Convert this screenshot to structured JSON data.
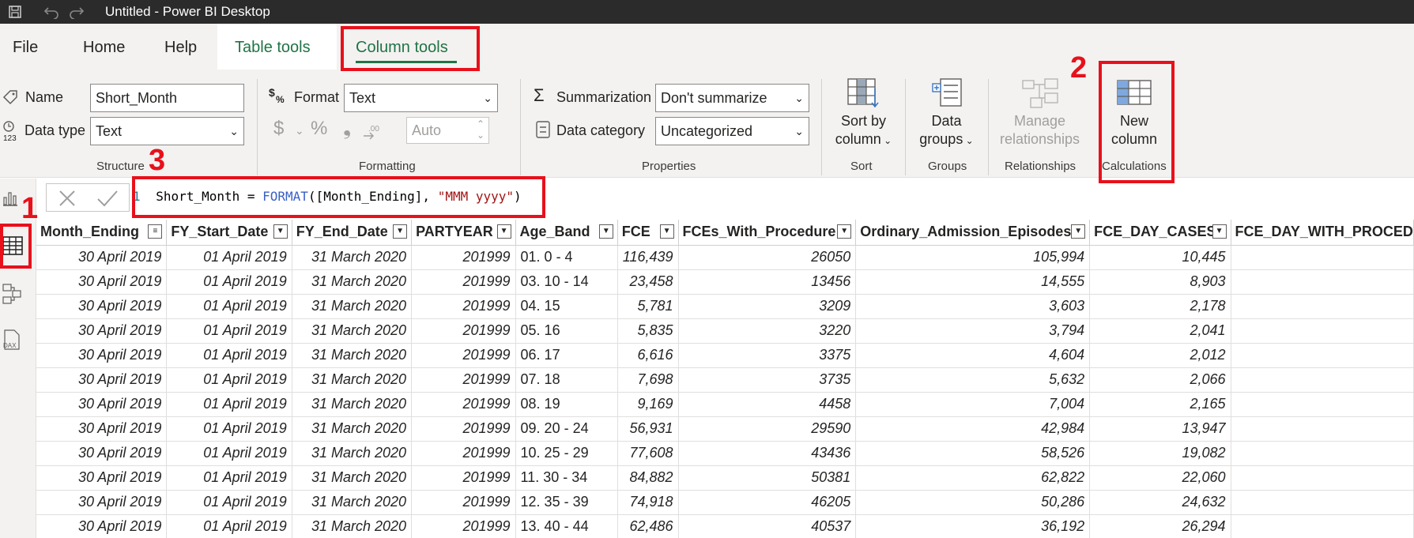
{
  "window": {
    "title": "Untitled - Power BI Desktop",
    "quick_access": [
      {
        "name": "save-icon",
        "glyph": "▭"
      },
      {
        "name": "undo-icon",
        "glyph": "↶"
      },
      {
        "name": "redo-icon",
        "glyph": "↷"
      }
    ]
  },
  "tabs": {
    "file": "File",
    "home": "Home",
    "help": "Help",
    "table_tools": "Table tools",
    "column_tools": "Column tools"
  },
  "structure": {
    "name_label": "Name",
    "name_value": "Short_Month",
    "datatype_label": "Data type",
    "datatype_value": "Text",
    "group_label": "Structure"
  },
  "formatting": {
    "format_label": "Format",
    "format_value": "Text",
    "currency": "$",
    "percent": "%",
    "comma": "❟",
    "decimals_icon": "⁺.⁰⁰",
    "auto_value": "Auto",
    "group_label": "Formatting"
  },
  "properties": {
    "summarization_label": "Summarization",
    "summarization_value": "Don't summarize",
    "category_label": "Data category",
    "category_value": "Uncategorized",
    "group_label": "Properties"
  },
  "sort": {
    "btn_line1": "Sort by",
    "btn_line2": "column",
    "group_label": "Sort"
  },
  "groups": {
    "btn_line1": "Data",
    "btn_line2": "groups",
    "group_label": "Groups"
  },
  "relationships": {
    "btn_line1": "Manage",
    "btn_line2": "relationships",
    "group_label": "Relationships"
  },
  "calculations": {
    "btn_line1": "New",
    "btn_line2": "column",
    "group_label": "Calculations"
  },
  "formula": {
    "line_number": "1",
    "part1": "Short_Month = ",
    "func": "FORMAT",
    "part2": "([Month_Ending], ",
    "string": "\"MMM yyyy\"",
    "part3": ")"
  },
  "annotations": {
    "n1": "1",
    "n2": "2",
    "n3": "3"
  },
  "colors": {
    "accent_green": "#217346",
    "annotation_red": "#e8101b",
    "titlebar": "#2b2b2b"
  },
  "table": {
    "columns": [
      "Month_Ending",
      "FY_Start_Date",
      "FY_End_Date",
      "PARTYEAR",
      "Age_Band",
      "FCE",
      "FCEs_With_Procedure",
      "Ordinary_Admission_Episodes",
      "FCE_DAY_CASES",
      "FCE_DAY_WITH_PROCED"
    ],
    "rows": [
      [
        "30 April 2019",
        "01 April 2019",
        "31 March 2020",
        "201999",
        "01. 0 - 4",
        "116,439",
        "26050",
        "105,994",
        "10,445",
        ""
      ],
      [
        "30 April 2019",
        "01 April 2019",
        "31 March 2020",
        "201999",
        "03. 10 - 14",
        "23,458",
        "13456",
        "14,555",
        "8,903",
        ""
      ],
      [
        "30 April 2019",
        "01 April 2019",
        "31 March 2020",
        "201999",
        "04. 15",
        "5,781",
        "3209",
        "3,603",
        "2,178",
        ""
      ],
      [
        "30 April 2019",
        "01 April 2019",
        "31 March 2020",
        "201999",
        "05. 16",
        "5,835",
        "3220",
        "3,794",
        "2,041",
        ""
      ],
      [
        "30 April 2019",
        "01 April 2019",
        "31 March 2020",
        "201999",
        "06. 17",
        "6,616",
        "3375",
        "4,604",
        "2,012",
        ""
      ],
      [
        "30 April 2019",
        "01 April 2019",
        "31 March 2020",
        "201999",
        "07. 18",
        "7,698",
        "3735",
        "5,632",
        "2,066",
        ""
      ],
      [
        "30 April 2019",
        "01 April 2019",
        "31 March 2020",
        "201999",
        "08. 19",
        "9,169",
        "4458",
        "7,004",
        "2,165",
        ""
      ],
      [
        "30 April 2019",
        "01 April 2019",
        "31 March 2020",
        "201999",
        "09. 20 - 24",
        "56,931",
        "29590",
        "42,984",
        "13,947",
        ""
      ],
      [
        "30 April 2019",
        "01 April 2019",
        "31 March 2020",
        "201999",
        "10. 25 - 29",
        "77,608",
        "43436",
        "58,526",
        "19,082",
        ""
      ],
      [
        "30 April 2019",
        "01 April 2019",
        "31 March 2020",
        "201999",
        "11. 30 - 34",
        "84,882",
        "50381",
        "62,822",
        "22,060",
        ""
      ],
      [
        "30 April 2019",
        "01 April 2019",
        "31 March 2020",
        "201999",
        "12. 35 - 39",
        "74,918",
        "46205",
        "50,286",
        "24,632",
        ""
      ],
      [
        "30 April 2019",
        "01 April 2019",
        "31 March 2020",
        "201999",
        "13. 40 - 44",
        "62,486",
        "40537",
        "36,192",
        "26,294",
        ""
      ]
    ]
  }
}
